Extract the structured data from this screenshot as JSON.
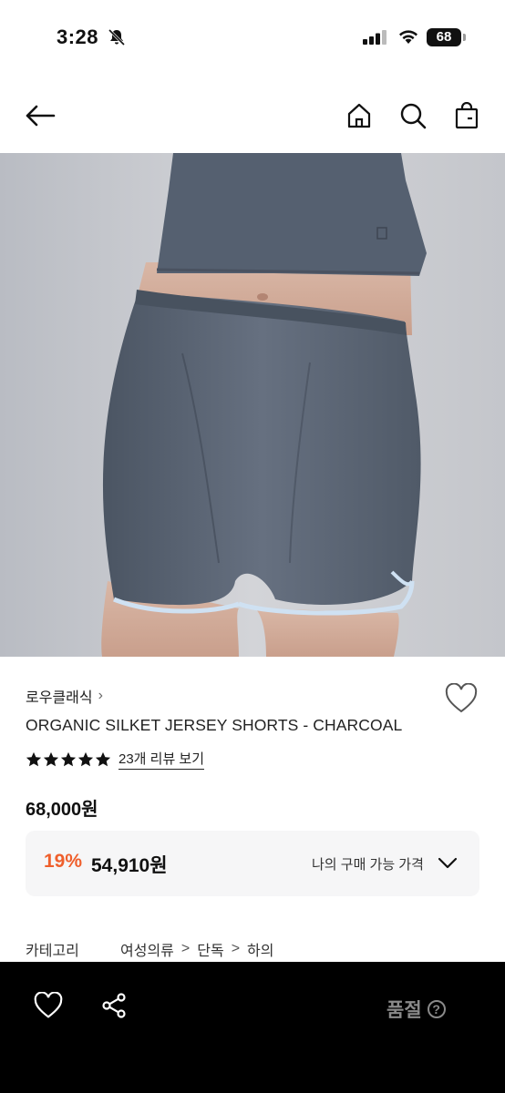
{
  "status_bar": {
    "time": "3:28",
    "battery": "68"
  },
  "header": {
    "back_icon": "arrow-left-icon",
    "home_icon": "home-icon",
    "search_icon": "search-icon",
    "bag_icon": "shopping-bag-icon"
  },
  "product": {
    "brand": "로우클래식",
    "brand_chevron": "›",
    "title": "ORGANIC SILKET JERSEY SHORTS - CHARCOAL",
    "rating_stars": 5,
    "review_link": "23개 리뷰 보기",
    "original_price": "68,000원",
    "discount_rate": "19%",
    "final_price": "54,910원",
    "my_price_label": "나의 구매 가능 가격"
  },
  "category": {
    "label": "카테고리",
    "path": [
      "여성의류",
      "단독",
      "하의"
    ],
    "separator": ">"
  },
  "bottom_bar": {
    "soldout_label": "품절",
    "help_glyph": "?"
  },
  "colors": {
    "discount": "#ef5f2c",
    "bottom_bar_bg": "#000000",
    "soldout_text": "#8a8a8a",
    "price_box_bg": "#f6f6f7"
  }
}
